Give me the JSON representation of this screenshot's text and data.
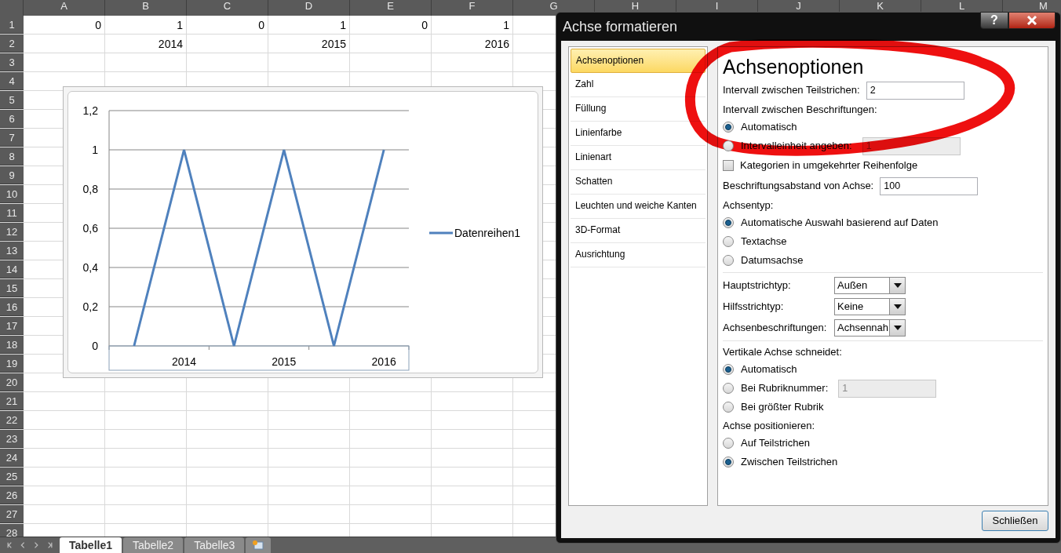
{
  "sheet": {
    "columns": [
      "A",
      "B",
      "C",
      "D",
      "E",
      "F",
      "G",
      "H",
      "I",
      "J",
      "K",
      "L",
      "M"
    ],
    "rows": [
      {
        "number": "1",
        "cells": [
          "0",
          "1",
          "0",
          "1",
          "0",
          "1"
        ]
      },
      {
        "number": "2",
        "cells": [
          null,
          "2014",
          null,
          "2015",
          null,
          "2016"
        ]
      },
      {
        "number": "3"
      },
      {
        "number": "4"
      },
      {
        "number": "5"
      },
      {
        "number": "6"
      },
      {
        "number": "7"
      },
      {
        "number": "8"
      },
      {
        "number": "9"
      },
      {
        "number": "10"
      },
      {
        "number": "11"
      },
      {
        "number": "12"
      },
      {
        "number": "13"
      },
      {
        "number": "14"
      },
      {
        "number": "15"
      },
      {
        "number": "16"
      },
      {
        "number": "17"
      },
      {
        "number": "18"
      },
      {
        "number": "19"
      },
      {
        "number": "20"
      },
      {
        "number": "21"
      },
      {
        "number": "22"
      },
      {
        "number": "23"
      },
      {
        "number": "24"
      },
      {
        "number": "25"
      },
      {
        "number": "26"
      },
      {
        "number": "27"
      },
      {
        "number": "28"
      }
    ]
  },
  "chart": {
    "chart_data": {
      "type": "line",
      "grid": true,
      "categories": [
        null,
        "2014",
        null,
        "2015",
        null,
        "2016"
      ],
      "series": [
        {
          "name": "Datenreihen1",
          "color": "#4f81bd",
          "values": [
            0,
            1,
            0,
            1,
            0,
            1
          ]
        }
      ],
      "ylim": [
        0,
        1.2
      ],
      "yticks": [
        {
          "value": 0,
          "label": "0"
        },
        {
          "value": 0.2,
          "label": "0,2"
        },
        {
          "value": 0.4,
          "label": "0,4"
        },
        {
          "value": 0.6,
          "label": "0,6"
        },
        {
          "value": 0.8,
          "label": "0,8"
        },
        {
          "value": 1,
          "label": "1"
        },
        {
          "value": 1.2,
          "label": "1,2"
        }
      ]
    }
  },
  "sheet_tabs": [
    {
      "label": "Tabelle1",
      "selected": true
    },
    {
      "label": "Tabelle2",
      "selected": false
    },
    {
      "label": "Tabelle3",
      "selected": false
    }
  ],
  "dialog": {
    "title": "Achse formatieren",
    "help": "?",
    "nav": [
      {
        "label": "Achsenoptionen",
        "selected": true
      },
      {
        "label": "Zahl",
        "selected": false
      },
      {
        "label": "Füllung",
        "selected": false
      },
      {
        "label": "Linienfarbe",
        "selected": false
      },
      {
        "label": "Linienart",
        "selected": false
      },
      {
        "label": "Schatten",
        "selected": false
      },
      {
        "label": "Leuchten und weiche Kanten",
        "selected": false
      },
      {
        "label": "3D-Format",
        "selected": false
      },
      {
        "label": "Ausrichtung",
        "selected": false
      }
    ],
    "items": [
      {
        "kind": "heading",
        "label": "Achsenoptionen"
      },
      {
        "kind": "field",
        "label": "Intervall zwischen Teilstrichen:",
        "value": "2"
      },
      {
        "kind": "label",
        "label": "Intervall zwischen Beschriftungen:"
      },
      {
        "kind": "radio",
        "label": "Automatisch",
        "selected": true
      },
      {
        "kind": "radio",
        "label": "Intervalleinheit angeben:",
        "selected": false,
        "value": "1",
        "disabled": true
      },
      {
        "kind": "checkbox",
        "label": "Kategorien in umgekehrter Reihenfolge",
        "checked": false
      },
      {
        "kind": "field",
        "label": "Beschriftungsabstand von Achse:",
        "value": "100"
      },
      {
        "kind": "label",
        "label": "Achsentyp:"
      },
      {
        "kind": "radio",
        "label": "Automatische Auswahl basierend auf Daten",
        "selected": true
      },
      {
        "kind": "radio",
        "label": "Textachse",
        "selected": false
      },
      {
        "kind": "radio",
        "label": "Datumsachse",
        "selected": false
      },
      {
        "kind": "separator"
      },
      {
        "kind": "dropdown",
        "label": "Hauptstrichtyp:",
        "value": "Außen"
      },
      {
        "kind": "dropdown",
        "label": "Hilfsstrichtyp:",
        "value": "Keine"
      },
      {
        "kind": "dropdown",
        "label": "Achsenbeschriftungen:",
        "value": "Achsennah"
      },
      {
        "kind": "separator"
      },
      {
        "kind": "label",
        "label": "Vertikale Achse schneidet:"
      },
      {
        "kind": "radio",
        "label": "Automatisch",
        "selected": true
      },
      {
        "kind": "radio",
        "label": "Bei Rubriknummer:",
        "selected": false,
        "value": "1",
        "disabled": true
      },
      {
        "kind": "radio",
        "label": "Bei größter Rubrik",
        "selected": false
      },
      {
        "kind": "label",
        "label": "Achse positionieren:"
      },
      {
        "kind": "radio",
        "label": "Auf Teilstrichen",
        "selected": false
      },
      {
        "kind": "radio",
        "label": "Zwischen Teilstrichen",
        "selected": true
      }
    ],
    "close_button": "Schließen"
  }
}
